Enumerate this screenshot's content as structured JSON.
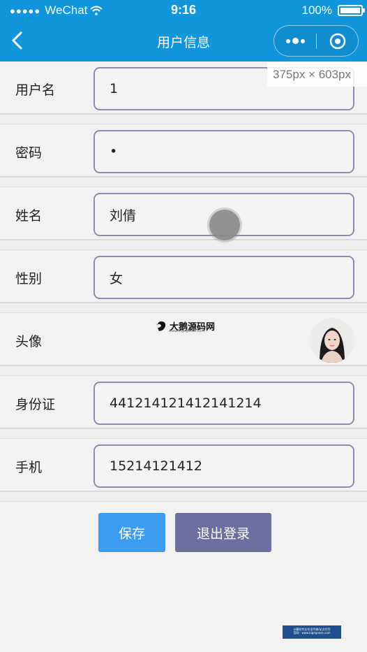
{
  "status_bar": {
    "carrier": "WeChat",
    "time": "9:16",
    "battery": "100%"
  },
  "nav": {
    "title": "用户信息"
  },
  "size_hint": "375px × 603px",
  "fields": [
    {
      "label": "用户名",
      "value": "1"
    },
    {
      "label": "密码",
      "value": "•"
    },
    {
      "label": "姓名",
      "value": "刘倩"
    },
    {
      "label": "性别",
      "value": "女"
    },
    {
      "label": "头像"
    },
    {
      "label": "身份证",
      "value": "441214121412141214"
    },
    {
      "label": "手机",
      "value": "15214121412"
    }
  ],
  "buttons": {
    "save": "保存",
    "logout": "退出登录"
  },
  "watermark": {
    "title": "大鹅源码网",
    "subtitle": "www.bigegoose.com"
  },
  "footer_badge": {
    "line1": "计算机专业毕设代做/论文代写",
    "line2": "官网：www.bigegoose.com"
  },
  "colors": {
    "primary": "#1296db",
    "save": "#3b9cf2",
    "logout": "#6c6f9f"
  }
}
